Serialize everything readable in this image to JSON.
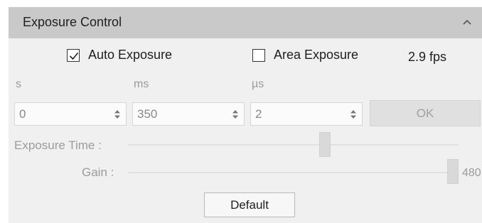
{
  "panel": {
    "title": "Exposure Control",
    "collapse_icon": "chevron-up-icon"
  },
  "options": {
    "auto_exposure": {
      "label": "Auto Exposure",
      "checked": true
    },
    "area_exposure": {
      "label": "Area Exposure",
      "checked": false
    },
    "fps": "2.9 fps"
  },
  "time_inputs": {
    "s": {
      "unit": "s",
      "value": "0"
    },
    "ms": {
      "unit": "ms",
      "value": "350"
    },
    "us": {
      "unit": "µs",
      "value": "2"
    }
  },
  "ok_label": "OK",
  "sliders": {
    "exposure_time": {
      "label": "Exposure Time :",
      "level": 0.6
    },
    "gain": {
      "label": "Gain :",
      "value": "480",
      "level": 1.0
    }
  },
  "default_label": "Default",
  "colors": {
    "header_bg": "#c9c9c9",
    "panel_bg": "#f0f0f0",
    "disabled_text": "#9c9c9c"
  }
}
